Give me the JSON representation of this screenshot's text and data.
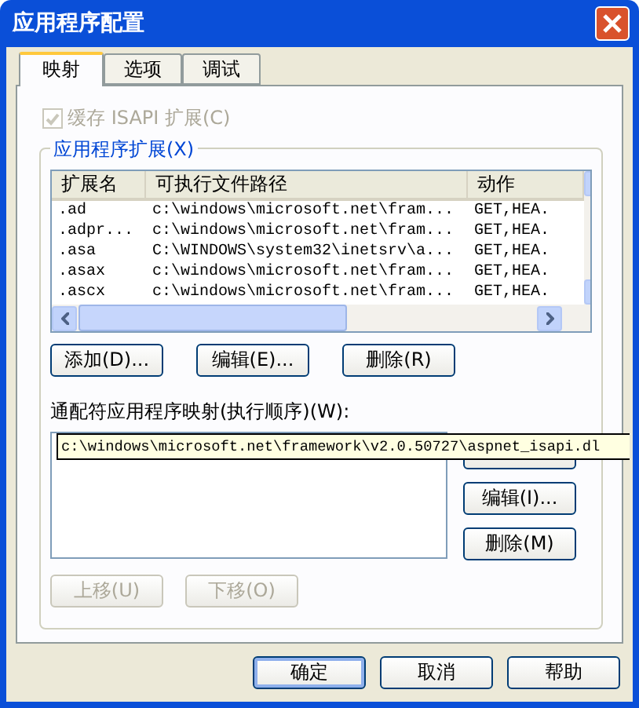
{
  "window": {
    "title": "应用程序配置"
  },
  "tabs": [
    {
      "label": "映射",
      "selected": true
    },
    {
      "label": "选项",
      "selected": false
    },
    {
      "label": "调试",
      "selected": false
    }
  ],
  "cache_isapi": {
    "label": "缓存 ISAPI 扩展(C)",
    "checked": true,
    "disabled": true
  },
  "extensions": {
    "title": "应用程序扩展(X)",
    "columns": [
      "扩展名",
      "可执行文件路径",
      "动作"
    ],
    "rows": [
      {
        "cells": [
          ".ad",
          "c:\\windows\\microsoft.net\\fram...",
          "GET,HEA."
        ],
        "selected": false
      },
      {
        "cells": [
          ".adpr...",
          "c:\\windows\\microsoft.net\\fram...",
          "GET,HEA."
        ],
        "selected": false
      },
      {
        "cells": [
          ".asa",
          "C:\\WINDOWS\\system32\\inetsrv\\a...",
          "GET,HEA."
        ],
        "selected": false
      },
      {
        "cells": [
          ".asax",
          "c:\\windows\\microsoft.net\\fram...",
          "GET,HEA."
        ],
        "selected": false
      },
      {
        "cells": [
          ".ascx",
          "c:\\windows\\microsoft.net\\fram...",
          "GET,HEA."
        ],
        "selected": false
      }
    ],
    "buttons": [
      "添加(D)...",
      "编辑(E)...",
      "删除(R)"
    ]
  },
  "wildcard": {
    "label": "通配符应用程序映射(执行顺序)(W):",
    "tooltip": "c:\\windows\\microsoft.net\\framework\\v2.0.50727\\aspnet_isapi.dl",
    "side_buttons": [
      {
        "label": "编辑(I)...",
        "disabled": false
      },
      {
        "label": "删除(M)",
        "disabled": false
      }
    ],
    "move_buttons": [
      {
        "label": "上移(U)",
        "disabled": true
      },
      {
        "label": "下移(O)",
        "disabled": true
      }
    ]
  },
  "buttons": [
    {
      "label": "确定",
      "default": true
    },
    {
      "label": "取消",
      "default": false
    },
    {
      "label": "帮助",
      "default": false
    }
  ]
}
